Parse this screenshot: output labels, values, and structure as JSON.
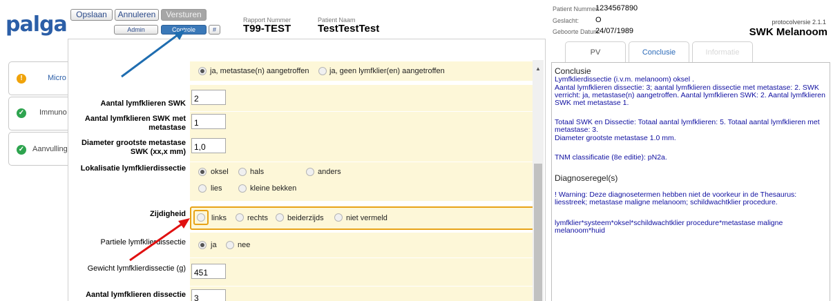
{
  "header": {
    "logo": "palga",
    "buttons": {
      "save": "Opslaan",
      "cancel": "Annuleren",
      "send": "Versturen",
      "admin": "Admin",
      "control": "Controle",
      "hash": "#"
    },
    "report_number_label": "Rapport Nummer",
    "report_number": "T99-TEST",
    "patient_name_label": "Patient Naam",
    "patient_name": "TestTestTest",
    "patient_number_label": "Patient Nummer:",
    "patient_number": "1234567890",
    "gender_label": "Geslacht:",
    "gender": "O",
    "dob_label": "Geboorte Datum:",
    "dob": "24/07/1989",
    "protocol_version": "protocolversie 2.1.1",
    "protocol_title": "SWK Melanoom"
  },
  "side_tabs": [
    {
      "label": "Micro",
      "status": "warning",
      "icon": "!"
    },
    {
      "label": "Immuno",
      "status": "ok",
      "icon": "✓"
    },
    {
      "label": "Aanvulling",
      "status": "ok",
      "icon": "✓"
    }
  ],
  "form": {
    "swk_result": {
      "options": [
        "ja, metastase(n) aangetroffen",
        "ja, geen lymfklier(en) aangetroffen"
      ],
      "selected": 0
    },
    "aantal_swk": {
      "label": "Aantal lymfklieren SWK",
      "value": "2"
    },
    "aantal_swk_met": {
      "label_line1": "Aantal lymfklieren SWK met",
      "label_line2": "metastase",
      "value": "1"
    },
    "diameter": {
      "label_line1": "Diameter grootste metastase",
      "label_line2": "SWK (xx,x mm)",
      "value": "1,0"
    },
    "lokalisatie": {
      "label": "Lokalisatie lymfklierdissectie",
      "options": [
        "oksel",
        "hals",
        "anders",
        "lies",
        "kleine bekken"
      ],
      "selected": 0
    },
    "zijdigheid": {
      "label": "Zijdigheid",
      "options": [
        "links",
        "rechts",
        "beiderzijds",
        "niet vermeld"
      ],
      "selected": -1
    },
    "partiele": {
      "label": "Partiele lymfklierdissectie",
      "options": [
        "ja",
        "nee"
      ],
      "selected": 0
    },
    "gewicht": {
      "label": "Gewicht lymfklierdissectie (g)",
      "value": "451"
    },
    "aantal_dissectie": {
      "label": "Aantal lymfklieren dissectie",
      "value": "3"
    }
  },
  "right_tabs": [
    {
      "label": "PV",
      "state": "normal"
    },
    {
      "label": "Conclusie",
      "state": "active"
    },
    {
      "label": "Informatie",
      "state": "disabled"
    }
  ],
  "conclusion": {
    "heading": "Conclusie",
    "p1": "Lymfklierdissectie (i.v.m. melanoom) oksel .",
    "p2": "Aantal lymfklieren dissectie: 3; aantal lymfklieren dissectie met metastase: 2. SWK verricht: ja, metastase(n) aangetroffen. Aantal lymfklieren SWK: 2. Aantal lymfklieren SWK met metastase 1.",
    "p3": "Totaal SWK en Dissectie: Totaal aantal lymfklieren: 5. Totaal aantal lymfklieren met metastase: 3.",
    "p4": "Diameter grootste metastase 1.0 mm.",
    "p5": "TNM classificatie (8e editie): pN2a.",
    "diag_heading": "Diagnoseregel(s)",
    "warning": "! Warning: Deze diagnosetermen hebben niet de voorkeur in de Thesaurus: liesstreek; metastase maligne melanoom; schildwachtklier procedure.",
    "diag_terms": "lymfklier*systeem*oksel*schildwachtklier procedure*metastase maligne melanoom*huid"
  },
  "colors": {
    "accent": "#3a78b8",
    "brand": "#2b5ea7",
    "field_bg": "#fdf7d8",
    "highlight_border": "#e8a317",
    "conclusion_text": "#0f0fa0",
    "arrow_blue": "#1f6db0",
    "arrow_red": "#e01010"
  }
}
